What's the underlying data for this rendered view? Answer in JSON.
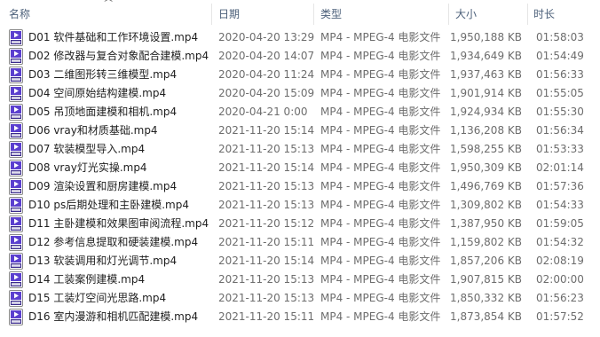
{
  "columns": {
    "name": "名称",
    "date": "日期",
    "type": "类型",
    "size": "大小",
    "duration": "时长"
  },
  "icon": "mp4-video-file-icon",
  "files": [
    {
      "name": "D01 软件基础和工作环境设置.mp4",
      "date": "2020-04-20 13:29",
      "type": "MP4 - MPEG-4 电影文件",
      "size": "1,950,188 KB",
      "duration": "01:58:03"
    },
    {
      "name": "D02 修改器与复合对象配合建模.mp4",
      "date": "2020-04-20 14:07",
      "type": "MP4 - MPEG-4 电影文件",
      "size": "1,934,649 KB",
      "duration": "01:54:49"
    },
    {
      "name": "D03 二维图形转三维模型.mp4",
      "date": "2020-04-20 11:24",
      "type": "MP4 - MPEG-4 电影文件",
      "size": "1,937,463 KB",
      "duration": "01:56:33"
    },
    {
      "name": "D04 空间原始结构建模.mp4",
      "date": "2020-04-20 15:09",
      "type": "MP4 - MPEG-4 电影文件",
      "size": "1,901,914 KB",
      "duration": "01:55:05"
    },
    {
      "name": "D05 吊顶地面建模和相机.mp4",
      "date": "2020-04-21 0:00",
      "type": "MP4 - MPEG-4 电影文件",
      "size": "1,924,934 KB",
      "duration": "01:55:30"
    },
    {
      "name": "D06 vray和材质基础.mp4",
      "date": "2021-11-20 15:14",
      "type": "MP4 - MPEG-4 电影文件",
      "size": "1,136,208 KB",
      "duration": "01:56:34"
    },
    {
      "name": "D07 软装模型导入.mp4",
      "date": "2021-11-20 15:13",
      "type": "MP4 - MPEG-4 电影文件",
      "size": "1,598,255 KB",
      "duration": "01:53:33"
    },
    {
      "name": "D08 vray灯光实操.mp4",
      "date": "2021-11-20 15:14",
      "type": "MP4 - MPEG-4 电影文件",
      "size": "1,950,309 KB",
      "duration": "02:01:14"
    },
    {
      "name": "D09 渲染设置和厨房建模.mp4",
      "date": "2021-11-20 15:13",
      "type": "MP4 - MPEG-4 电影文件",
      "size": "1,496,769 KB",
      "duration": "01:57:36"
    },
    {
      "name": "D10 ps后期处理和主卧建模.mp4",
      "date": "2021-11-20 15:13",
      "type": "MP4 - MPEG-4 电影文件",
      "size": "1,309,802 KB",
      "duration": "01:54:33"
    },
    {
      "name": "D11 主卧建模和效果图审阅流程.mp4",
      "date": "2021-11-20 15:12",
      "type": "MP4 - MPEG-4 电影文件",
      "size": "1,387,950 KB",
      "duration": "01:59:05"
    },
    {
      "name": "D12 参考信息提取和硬装建模.mp4",
      "date": "2021-11-20 15:11",
      "type": "MP4 - MPEG-4 电影文件",
      "size": "1,159,802 KB",
      "duration": "01:54:32"
    },
    {
      "name": "D13 软装调用和灯光调节.mp4",
      "date": "2021-11-20 15:14",
      "type": "MP4 - MPEG-4 电影文件",
      "size": "1,857,206 KB",
      "duration": "02:08:19"
    },
    {
      "name": "D14 工装案例建模.mp4",
      "date": "2021-11-20 15:13",
      "type": "MP4 - MPEG-4 电影文件",
      "size": "1,907,815 KB",
      "duration": "02:00:00"
    },
    {
      "name": "D15 工装灯空间光思路.mp4",
      "date": "2021-11-20 15:13",
      "type": "MP4 - MPEG-4 电影文件",
      "size": "1,850,332 KB",
      "duration": "01:56:23"
    },
    {
      "name": "D16 室内漫游和相机匹配建模.mp4",
      "date": "2021-11-20 15:11",
      "type": "MP4 - MPEG-4 电影文件",
      "size": "1,873,854 KB",
      "duration": "01:57:52"
    }
  ]
}
